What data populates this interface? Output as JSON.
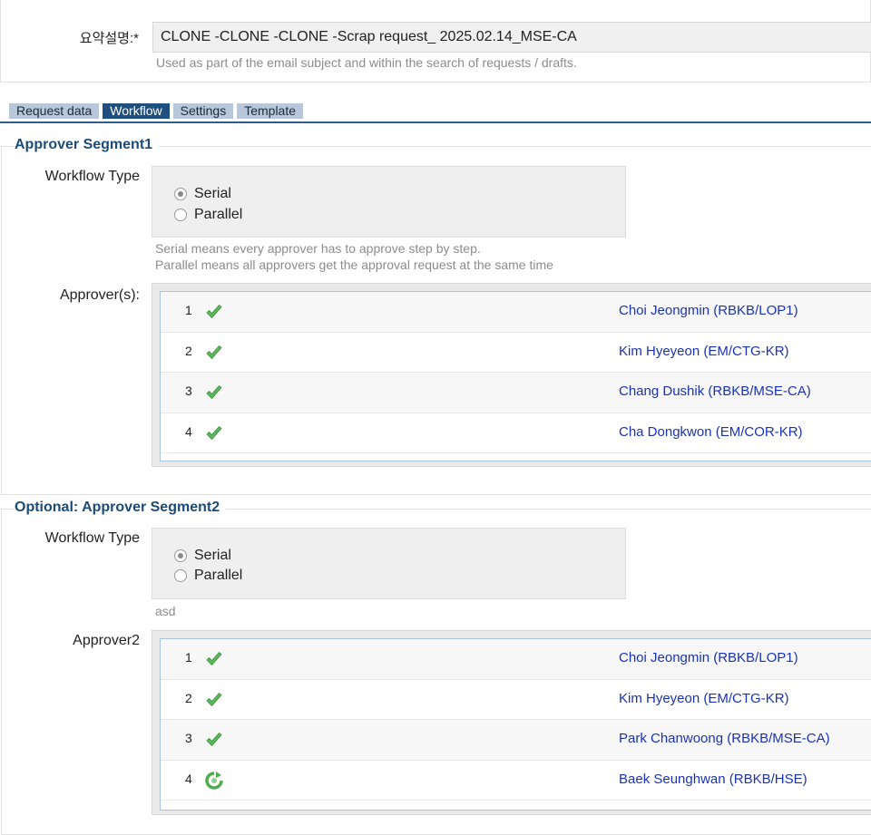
{
  "summary": {
    "label": "요약설명:*",
    "value": "CLONE -CLONE -CLONE -Scrap request_ 2025.02.14_MSE-CA",
    "hint": "Used as part of the email subject and within the search of requests / drafts."
  },
  "tabs": [
    {
      "label": "Request data",
      "active": false
    },
    {
      "label": "Workflow",
      "active": true
    },
    {
      "label": "Settings",
      "active": false
    },
    {
      "label": "Template",
      "active": false
    }
  ],
  "segment1": {
    "title": "Approver Segment1",
    "workflow_label": "Workflow Type",
    "options": [
      {
        "label": "Serial",
        "checked": true
      },
      {
        "label": "Parallel",
        "checked": false
      }
    ],
    "hint1": "Serial means every approver has to approve step by step.",
    "hint2": "Parallel means all approvers get the approval request at the same time",
    "approvers_label": "Approver(s):",
    "approvers": [
      {
        "num": "1",
        "status_icon": "check-icon",
        "name": "Choi Jeongmin (RBKB/LOP1)"
      },
      {
        "num": "2",
        "status_icon": "check-icon",
        "name": "Kim Hyeyeon (EM/CTG-KR)"
      },
      {
        "num": "3",
        "status_icon": "check-icon",
        "name": "Chang Dushik (RBKB/MSE-CA)"
      },
      {
        "num": "4",
        "status_icon": "check-icon",
        "name": "Cha Dongkwon (EM/COR-KR)"
      }
    ]
  },
  "segment2": {
    "title": "Optional: Approver Segment2",
    "workflow_label": "Workflow Type",
    "options": [
      {
        "label": "Serial",
        "checked": true
      },
      {
        "label": "Parallel",
        "checked": false
      }
    ],
    "hint1": "asd",
    "approvers_label": "Approver2",
    "approvers": [
      {
        "num": "1",
        "status_icon": "check-icon",
        "name": "Choi Jeongmin (RBKB/LOP1)"
      },
      {
        "num": "2",
        "status_icon": "check-icon",
        "name": "Kim Hyeyeon (EM/CTG-KR)"
      },
      {
        "num": "3",
        "status_icon": "check-icon",
        "name": "Park Chanwoong (RBKB/MSE-CA)"
      },
      {
        "num": "4",
        "status_icon": "pending-icon",
        "name": "Baek Seunghwan (RBKB/HSE)"
      }
    ]
  },
  "colors": {
    "link": "#1a32b8",
    "section_title": "#1d4b77",
    "tab_active": "#1f4f7c",
    "tab_inactive": "#b8c7d9",
    "check_green": "#5cb85c"
  }
}
